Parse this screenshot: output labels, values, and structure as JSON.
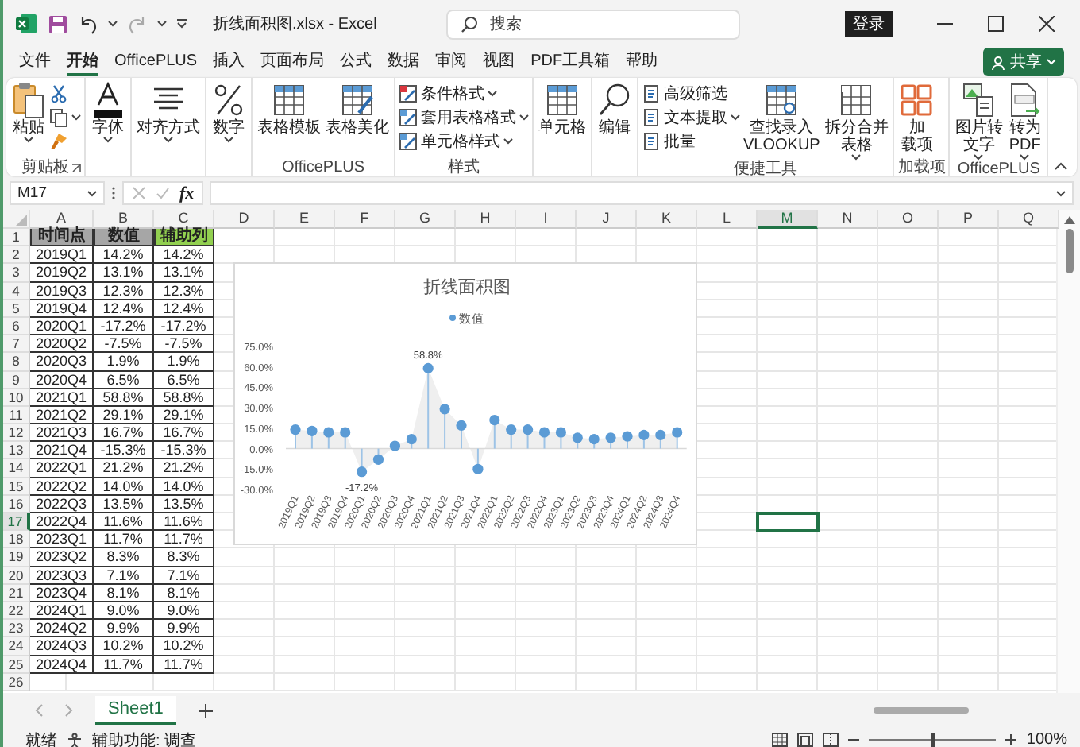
{
  "title_bar": {
    "title": "折线面积图.xlsx  -  Excel",
    "search": {
      "placeholder": "搜索"
    },
    "login": "登录"
  },
  "menu": [
    {
      "label": "文件",
      "selected": false
    },
    {
      "label": "开始",
      "selected": true
    },
    {
      "label": "OfficePLUS",
      "selected": false
    },
    {
      "label": "插入",
      "selected": false
    },
    {
      "label": "页面布局",
      "selected": false
    },
    {
      "label": "公式",
      "selected": false
    },
    {
      "label": "数据",
      "selected": false
    },
    {
      "label": "审阅",
      "selected": false
    },
    {
      "label": "视图",
      "selected": false
    },
    {
      "label": "PDF工具箱",
      "selected": false
    },
    {
      "label": "帮助",
      "selected": false
    }
  ],
  "share": "共享",
  "ribbon": {
    "groups": [
      {
        "label": "剪贴板",
        "launcher": true,
        "buttons": [
          {
            "kind": "large",
            "lines": [
              "粘贴"
            ],
            "dropdown": true
          },
          {
            "kind": "icon",
            "dropdown": false
          },
          {
            "kind": "icon",
            "dropdown": true
          },
          {
            "kind": "icon",
            "dropdown": false
          }
        ]
      },
      {
        "buttons": [
          {
            "kind": "large",
            "lines": [
              "字体"
            ],
            "dropdown": true
          }
        ]
      },
      {
        "buttons": [
          {
            "kind": "large",
            "lines": [
              "对齐方式"
            ],
            "dropdown": true
          }
        ]
      },
      {
        "buttons": [
          {
            "kind": "large",
            "lines": [
              "数字"
            ],
            "dropdown": true
          }
        ]
      },
      {
        "label": "OfficePLUS",
        "buttons": [
          {
            "kind": "large",
            "lines": [
              "表格模板"
            ],
            "dropdown": false
          },
          {
            "kind": "large",
            "lines": [
              "表格美化"
            ],
            "dropdown": false
          }
        ]
      },
      {
        "label": "样式",
        "buttons": [
          {
            "kind": "small",
            "label": "条件格式",
            "dropdown": true
          },
          {
            "kind": "small",
            "label": "套用表格格式",
            "dropdown": true
          },
          {
            "kind": "small",
            "label": "单元格样式",
            "dropdown": true
          }
        ]
      },
      {
        "buttons": [
          {
            "kind": "large",
            "lines": [
              "单元格"
            ],
            "dropdown": false
          }
        ]
      },
      {
        "buttons": [
          {
            "kind": "large",
            "lines": [
              "编辑"
            ],
            "dropdown": false
          }
        ]
      },
      {
        "label": "便捷工具",
        "buttons": [
          {
            "kind": "small",
            "label": "高级筛选",
            "dropdown": false
          },
          {
            "kind": "small",
            "label": "文本提取",
            "dropdown": true
          },
          {
            "kind": "small",
            "label": "批量",
            "dropdown": false
          },
          {
            "kind": "large",
            "lines": [
              "查找录入",
              "VLOOKUP"
            ],
            "dropdown": false
          },
          {
            "kind": "large",
            "lines": [
              "拆分合并",
              "表格"
            ],
            "dropdown": true
          }
        ]
      },
      {
        "label": "加载项",
        "buttons": [
          {
            "kind": "large",
            "lines": [
              "加",
              "载项"
            ],
            "dropdown": false
          }
        ]
      },
      {
        "label": "OfficePLUS",
        "buttons": [
          {
            "kind": "large",
            "lines": [
              "图片转",
              "文字"
            ],
            "dropdown": true
          },
          {
            "kind": "large",
            "lines": [
              "转为",
              "PDF"
            ],
            "dropdown": true
          }
        ]
      }
    ]
  },
  "formula_bar": {
    "name_box": "M17",
    "function_label": "fx"
  },
  "sheet": {
    "columns": [
      {
        "label": "A",
        "selected": false
      },
      {
        "label": "B",
        "selected": false
      },
      {
        "label": "C",
        "selected": false
      },
      {
        "label": "D",
        "selected": false
      },
      {
        "label": "E",
        "selected": false
      },
      {
        "label": "F",
        "selected": false
      },
      {
        "label": "G",
        "selected": false
      },
      {
        "label": "H",
        "selected": false
      },
      {
        "label": "I",
        "selected": false
      },
      {
        "label": "J",
        "selected": false
      },
      {
        "label": "K",
        "selected": false
      },
      {
        "label": "L",
        "selected": false
      },
      {
        "label": "M",
        "selected": true
      },
      {
        "label": "N",
        "selected": false
      },
      {
        "label": "O",
        "selected": false
      },
      {
        "label": "P",
        "selected": false
      },
      {
        "label": "Q",
        "selected": false
      }
    ],
    "rows": [
      {
        "label": "1",
        "selected": false
      },
      {
        "label": "2",
        "selected": false
      },
      {
        "label": "3",
        "selected": false
      },
      {
        "label": "4",
        "selected": false
      },
      {
        "label": "5",
        "selected": false
      },
      {
        "label": "6",
        "selected": false
      },
      {
        "label": "7",
        "selected": false
      },
      {
        "label": "8",
        "selected": false
      },
      {
        "label": "9",
        "selected": false
      },
      {
        "label": "10",
        "selected": false
      },
      {
        "label": "11",
        "selected": false
      },
      {
        "label": "12",
        "selected": false
      },
      {
        "label": "13",
        "selected": false
      },
      {
        "label": "14",
        "selected": false
      },
      {
        "label": "15",
        "selected": false
      },
      {
        "label": "16",
        "selected": false
      },
      {
        "label": "17",
        "selected": true
      },
      {
        "label": "18",
        "selected": false
      },
      {
        "label": "19",
        "selected": false
      },
      {
        "label": "20",
        "selected": false
      },
      {
        "label": "21",
        "selected": false
      },
      {
        "label": "22",
        "selected": false
      },
      {
        "label": "23",
        "selected": false
      },
      {
        "label": "24",
        "selected": false
      },
      {
        "label": "25",
        "selected": false
      },
      {
        "label": "26",
        "selected": false
      }
    ],
    "table": {
      "header": [
        {
          "text": "时间点",
          "color": "#a6a6a6"
        },
        {
          "text": "数值",
          "color": "#a6a6a6"
        },
        {
          "text": "辅助列",
          "color": "#92d050"
        }
      ],
      "rows": [
        [
          "2019Q1",
          "14.2%",
          "14.2%"
        ],
        [
          "2019Q2",
          "13.1%",
          "13.1%"
        ],
        [
          "2019Q3",
          "12.3%",
          "12.3%"
        ],
        [
          "2019Q4",
          "12.4%",
          "12.4%"
        ],
        [
          "2020Q1",
          "-17.2%",
          "-17.2%"
        ],
        [
          "2020Q2",
          "-7.5%",
          "-7.5%"
        ],
        [
          "2020Q3",
          "1.9%",
          "1.9%"
        ],
        [
          "2020Q4",
          "6.5%",
          "6.5%"
        ],
        [
          "2021Q1",
          "58.8%",
          "58.8%"
        ],
        [
          "2021Q2",
          "29.1%",
          "29.1%"
        ],
        [
          "2021Q3",
          "16.7%",
          "16.7%"
        ],
        [
          "2021Q4",
          "-15.3%",
          "-15.3%"
        ],
        [
          "2022Q1",
          "21.2%",
          "21.2%"
        ],
        [
          "2022Q2",
          "14.0%",
          "14.0%"
        ],
        [
          "2022Q3",
          "13.5%",
          "13.5%"
        ],
        [
          "2022Q4",
          "11.6%",
          "11.6%"
        ],
        [
          "2023Q1",
          "11.7%",
          "11.7%"
        ],
        [
          "2023Q2",
          "8.3%",
          "8.3%"
        ],
        [
          "2023Q3",
          "7.1%",
          "7.1%"
        ],
        [
          "2023Q4",
          "8.1%",
          "8.1%"
        ],
        [
          "2024Q1",
          "9.0%",
          "9.0%"
        ],
        [
          "2024Q2",
          "9.9%",
          "9.9%"
        ],
        [
          "2024Q3",
          "10.2%",
          "10.2%"
        ],
        [
          "2024Q4",
          "11.7%",
          "11.7%"
        ]
      ]
    },
    "chart": {
      "chart_data": {
        "type": "area",
        "title": "折线面积图",
        "categories": [
          "2019Q1",
          "2019Q2",
          "2019Q3",
          "2019Q4",
          "2020Q1",
          "2020Q2",
          "2020Q3",
          "2020Q4",
          "2021Q1",
          "2021Q2",
          "2021Q3",
          "2021Q4",
          "2022Q1",
          "2022Q2",
          "2022Q3",
          "2022Q4",
          "2023Q1",
          "2023Q2",
          "2023Q3",
          "2023Q4",
          "2024Q1",
          "2024Q2",
          "2024Q3",
          "2024Q4"
        ],
        "series": [
          {
            "name": "数值",
            "color": "#5b9bd5",
            "values": [
              14,
              13,
              12,
              12,
              -17,
              -8,
              2,
              7,
              59,
              29,
              17,
              -15,
              21,
              14,
              14,
              12,
              12,
              8,
              7,
              8,
              9,
              10,
              10,
              12
            ]
          }
        ],
        "ylim": [
          -30,
          75
        ],
        "yticks": [
          {
            "value": 75,
            "label": "75.0%"
          },
          {
            "value": 60,
            "label": "60.0%"
          },
          {
            "value": 45,
            "label": "45.0%"
          },
          {
            "value": 30,
            "label": "30.0%"
          },
          {
            "value": 15,
            "label": "15.0%"
          },
          {
            "value": 0,
            "label": "0.0%"
          },
          {
            "value": -15,
            "label": "-15.0%"
          },
          {
            "value": -30,
            "label": "-30.0%"
          }
        ],
        "annotations": [
          {
            "x": "2021Q1",
            "text": "58.8%"
          },
          {
            "x": "2020Q1",
            "text": "-17.2%"
          }
        ]
      }
    }
  },
  "sheet_tabs": [
    {
      "label": "Sheet1",
      "selected": true
    }
  ],
  "status_bar": {
    "status": "就绪",
    "accessibility": "辅助功能: 调查",
    "zoom": {
      "level": 0.5,
      "reading": "100%"
    }
  }
}
